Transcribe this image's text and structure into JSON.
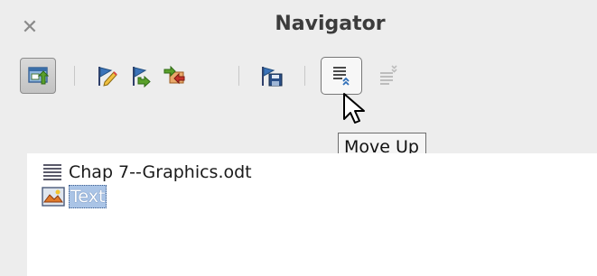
{
  "navigator": {
    "title": "Navigator",
    "close_icon": "close-icon",
    "toolbar": [
      {
        "name": "content-view-toggle",
        "icon": "content-view-icon",
        "state": "pressed"
      },
      {
        "name": "promote-chapter",
        "icon": "flag-pencil-icon"
      },
      {
        "name": "demote-chapter",
        "icon": "flag-arrow-icon"
      },
      {
        "name": "insert",
        "icon": "insert-arrows-icon"
      },
      {
        "name": "save-contents",
        "icon": "save-flag-icon"
      },
      {
        "name": "move-up",
        "icon": "move-up-icon",
        "state": "hovered"
      },
      {
        "name": "move-down",
        "icon": "move-down-icon",
        "state": "disabled"
      }
    ],
    "tooltip": "Move Up",
    "tree": [
      {
        "label": "Chap 7--Graphics.odt",
        "icon": "document-icon"
      },
      {
        "label": "Text",
        "icon": "text-object-icon",
        "selected": true
      }
    ],
    "colors": {
      "panel_bg": "#ededed",
      "list_bg": "#ffffff",
      "selection": "#aac4e6",
      "icon_green": "#5a9a2e",
      "icon_blue": "#2f6fb8"
    }
  }
}
